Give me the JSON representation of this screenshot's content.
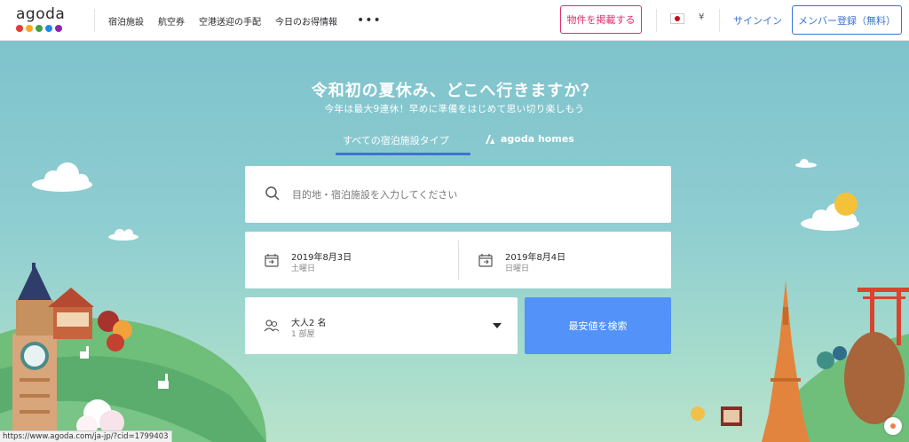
{
  "logo": {
    "text": "agoda",
    "dot_colors": [
      "#e53935",
      "#f9a825",
      "#43a047",
      "#1e88e5",
      "#8e24aa"
    ]
  },
  "nav": {
    "items": [
      "宿泊施設",
      "航空券",
      "空港送迎の手配",
      "今日のお得情報"
    ],
    "more": "•••"
  },
  "header": {
    "list_property": "物件を掲載する",
    "currency": "¥",
    "signin": "サインイン",
    "register": "メンバー登録（無料）"
  },
  "hero": {
    "headline": "令和初の夏休み、どこへ行きますか？",
    "subline": "今年は最大9連休！早めに準備をはじめて思い切り楽しもう",
    "tab_all": "すべての宿泊施設タイプ",
    "tab_homes": "agoda homes"
  },
  "search": {
    "placeholder": "目的地・宿泊施設を入力してください",
    "checkin": {
      "date": "2019年8月3日",
      "day": "土曜日"
    },
    "checkout": {
      "date": "2019年8月4日",
      "day": "日曜日"
    },
    "guests": {
      "main": "大人2 名",
      "rooms": "1 部屋"
    },
    "button": "最安値を検索"
  },
  "status_url": "https://www.agoda.com/ja-jp/?cid=1799403",
  "colors": {
    "accent_blue": "#5392f9",
    "link_blue": "#3a73d4",
    "pink": "#e12d6c",
    "sky": "#7fc3cc"
  }
}
